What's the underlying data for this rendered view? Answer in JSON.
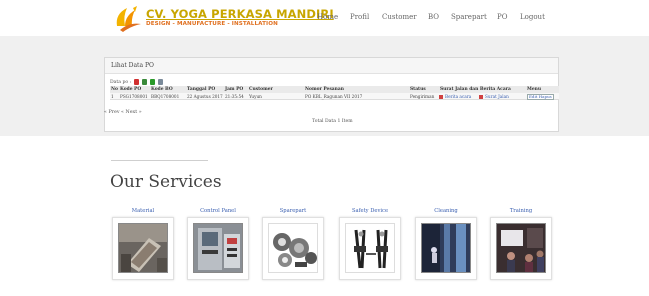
{
  "brand": {
    "name": "CV. YOGA PERKASA MANDIRI",
    "tagline": "DESIGN - MANUFACTURE - INSTALLATION"
  },
  "nav": [
    "Home",
    "Profil",
    "Customer",
    "BO",
    "Sparepart",
    "PO",
    "Logout"
  ],
  "panel": {
    "title": "Lihat Data PO",
    "export_label": "Data po :",
    "columns": [
      "No",
      "Kode PO",
      "Kode BO",
      "Tanggal PO",
      "Jam PO",
      "Customer",
      "Nomor Pesanan",
      "Status",
      "Surat Jalan dan Berita Acara",
      "Menu"
    ],
    "rows": [
      {
        "no": "1",
        "kode_po": "PSG1708001",
        "kode_bo": "BBQ1708001",
        "tanggal_po": "22 Agustus 2017",
        "jam_po": "21:35:54",
        "customer": "Yuyun",
        "nomor_pesanan": "PO KBL_Ragunan VII 2017",
        "status": "Pengiriman",
        "berita_acara": "Berita acara",
        "surat_jalan": "Surat Jalan",
        "menu": "Edit Hapus"
      }
    ],
    "pager": "« Prev « Next »",
    "total": "Total Data 1 Item"
  },
  "services": {
    "title": "Our Services",
    "items": [
      {
        "label": "Material",
        "icon": "material-photo"
      },
      {
        "label": "Control Panel",
        "icon": "control-panel-photo"
      },
      {
        "label": "Sparepart",
        "icon": "sparepart-photo"
      },
      {
        "label": "Safety Device",
        "icon": "safety-harness-photo"
      },
      {
        "label": "Cleaning",
        "icon": "cleaning-photo"
      },
      {
        "label": "Training",
        "icon": "training-photo"
      }
    ]
  },
  "colors": {
    "brand_gold": "#c8a600",
    "brand_orange": "#e07020",
    "link": "#3a5fb0",
    "band_gray": "#f0f0f0"
  }
}
